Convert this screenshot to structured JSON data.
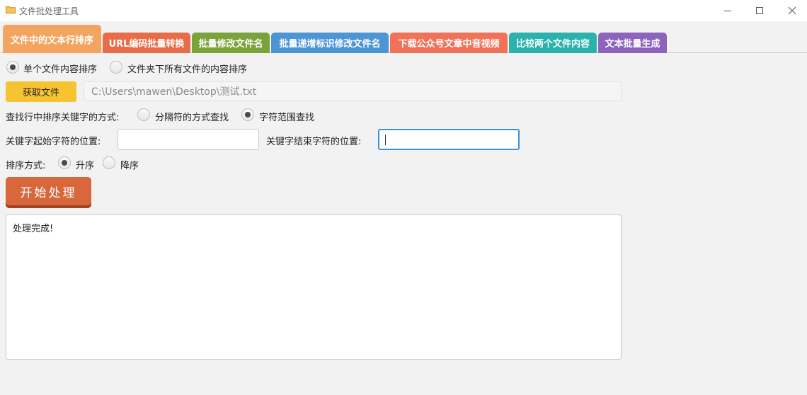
{
  "window": {
    "title": "文件批处理工具"
  },
  "tabs": [
    {
      "label": "文件中的文本行排序",
      "color": "#f3a560",
      "active": true
    },
    {
      "label": "URL编码批量转换",
      "color": "#e96c48"
    },
    {
      "label": "批量修改文件名",
      "color": "#7ba33b"
    },
    {
      "label": "批量递增标识修改文件名",
      "color": "#4e95d6"
    },
    {
      "label": "下载公众号文章中音视频",
      "color": "#f07259"
    },
    {
      "label": "比较两个文件内容",
      "color": "#2ab3ad"
    },
    {
      "label": "文本批量生成",
      "color": "#8d63bd"
    }
  ],
  "mode": {
    "single_file": "单个文件内容排序",
    "folder": "文件夹下所有文件的内容排序",
    "selected": "single_file"
  },
  "file": {
    "get_button": "获取文件",
    "path": "C:\\Users\\mawen\\Desktop\\测试.txt"
  },
  "keyword_find": {
    "label": "查找行中排序关键字的方式:",
    "by_separator": "分隔符的方式查找",
    "by_range": "字符范围查找",
    "selected": "by_range"
  },
  "range": {
    "start_label": "关键字起始字符的位置:",
    "start_value": "",
    "end_label": "关键字结束字符的位置:",
    "end_value": ""
  },
  "sort": {
    "label": "排序方式:",
    "asc": "升序",
    "desc": "降序",
    "selected": "asc"
  },
  "start_button": "开始处理",
  "output": {
    "text": "处理完成!"
  }
}
